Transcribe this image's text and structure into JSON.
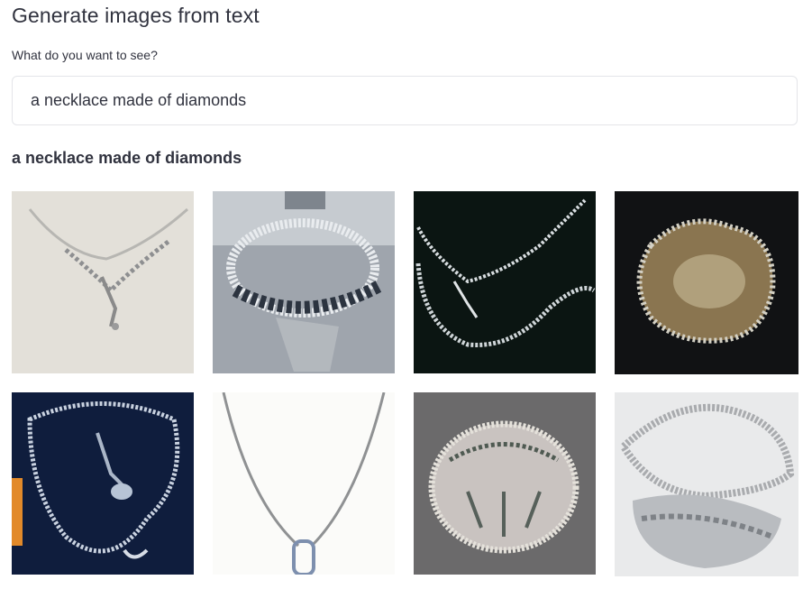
{
  "page": {
    "title": "Generate images from text",
    "prompt_label": "What do you want to see?",
    "prompt_value": "a necklace made of diamonds",
    "result_heading": "a necklace made of diamonds"
  },
  "images": [
    {
      "name": "generated-image-1",
      "background": "#e3e0d9",
      "tone": "light"
    },
    {
      "name": "generated-image-2",
      "background": "#9fa5ad",
      "tone": "grey"
    },
    {
      "name": "generated-image-3",
      "background": "#0b1512",
      "tone": "dark"
    },
    {
      "name": "generated-image-4",
      "background": "#111214",
      "tone": "dark"
    },
    {
      "name": "generated-image-5",
      "background": "#0f1d3d",
      "tone": "navy"
    },
    {
      "name": "generated-image-6",
      "background": "#fbfbf9",
      "tone": "white"
    },
    {
      "name": "generated-image-7",
      "background": "#6b6a6b",
      "tone": "grey"
    },
    {
      "name": "generated-image-8",
      "background": "#e9eaeb",
      "tone": "light"
    }
  ]
}
